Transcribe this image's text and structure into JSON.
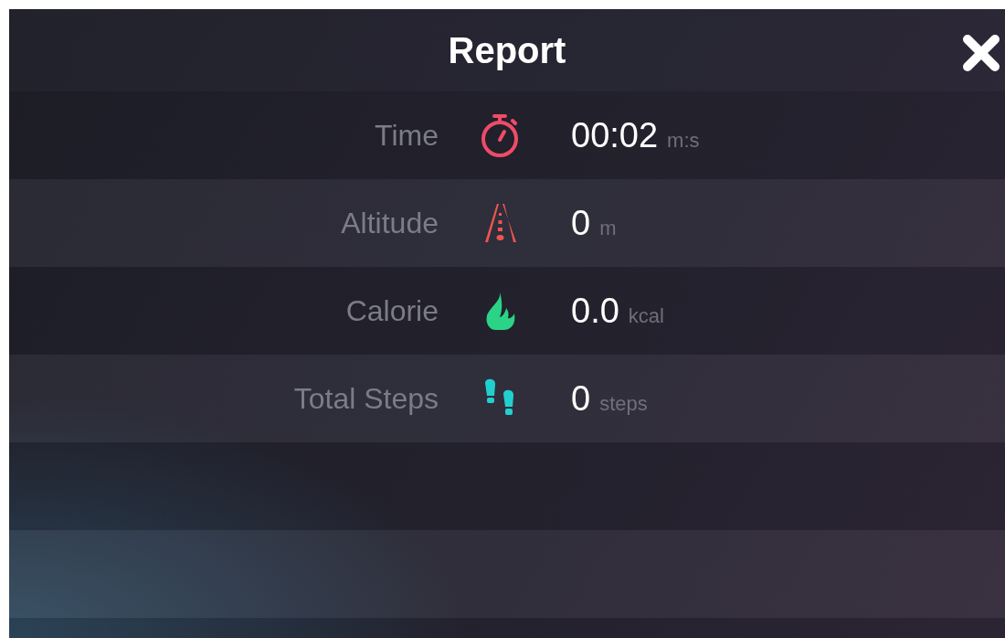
{
  "window": {
    "title": "Report"
  },
  "stats": [
    {
      "label": "Time",
      "kind": "time",
      "color": "#ef4b68",
      "value": "00:02",
      "unit": "m:s"
    },
    {
      "label": "Altitude",
      "kind": "altitude",
      "color": "#ee5550",
      "value": "0",
      "unit": "m"
    },
    {
      "label": "Calorie",
      "kind": "calorie",
      "color": "#2bd386",
      "value": "0.0",
      "unit": "kcal"
    },
    {
      "label": "Total Steps",
      "kind": "steps",
      "color": "#22cfd0",
      "value": "0",
      "unit": "steps"
    }
  ]
}
